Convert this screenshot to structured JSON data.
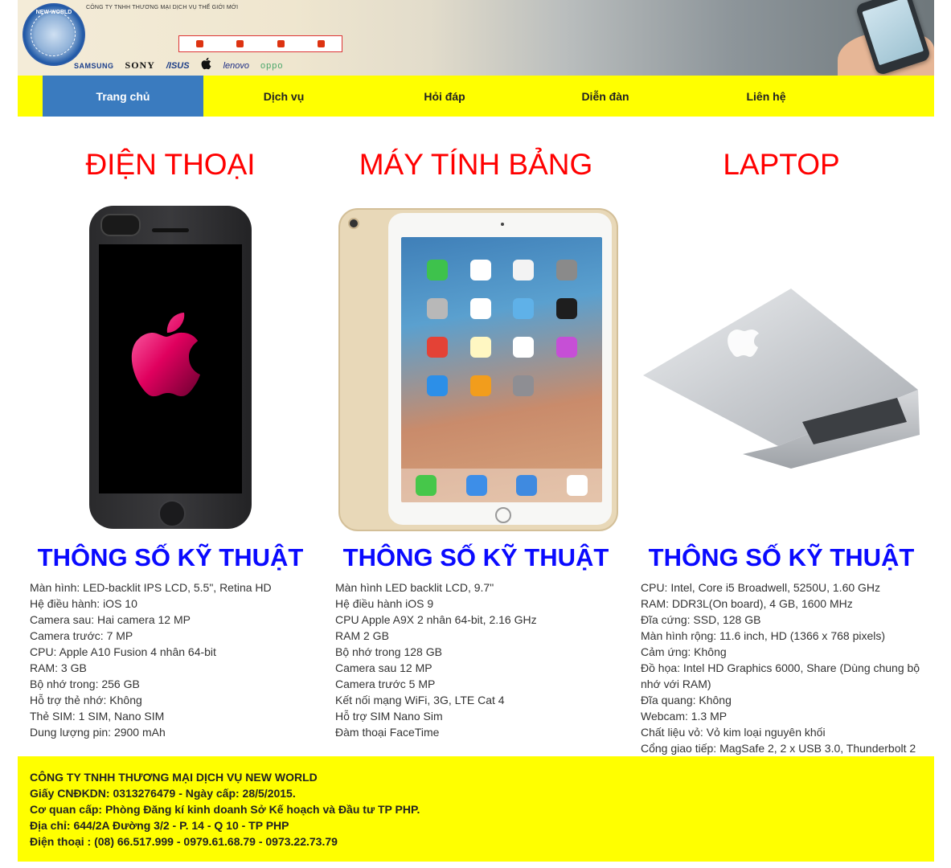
{
  "banner": {
    "company_small": "CÔNG TY TNHH THƯƠNG MẠI DỊCH VỤ THẾ GIỚI MỚI",
    "logo_text": "NEW WORLD",
    "brands": [
      "SAMSUNG",
      "SONY",
      "/ISUS",
      "",
      "lenovo",
      "oppo"
    ]
  },
  "nav": {
    "items": [
      {
        "label": "Trang chủ",
        "active": true
      },
      {
        "label": "Dịch vụ",
        "active": false
      },
      {
        "label": "Hỏi đáp",
        "active": false
      },
      {
        "label": "Diễn đàn",
        "active": false
      },
      {
        "label": "Liên hệ",
        "active": false
      }
    ]
  },
  "columns": [
    {
      "title": "ĐIỆN THOẠI",
      "spec_title": "THÔNG SỐ KỸ THUẬT",
      "specs": [
        "Màn hình: LED-backlit IPS LCD, 5.5\", Retina HD",
        "Hệ điều hành: iOS 10",
        "Camera sau: Hai camera 12 MP",
        "Camera trước: 7 MP",
        "CPU: Apple A10 Fusion 4 nhân 64-bit",
        "RAM: 3 GB",
        "Bộ nhớ trong: 256 GB",
        "Hỗ trợ thẻ nhớ: Không",
        "Thẻ SIM: 1 SIM, Nano SIM",
        "Dung lượng pin: 2900 mAh"
      ]
    },
    {
      "title": "MÁY TÍNH BẢNG",
      "spec_title": "THÔNG SỐ KỸ THUẬT",
      "specs": [
        "Màn hình LED backlit LCD, 9.7\"",
        "Hệ điều hành iOS 9",
        "CPU Apple A9X 2 nhân 64-bit, 2.16 GHz",
        "RAM 2 GB",
        "Bộ nhớ trong 128 GB",
        "Camera sau 12 MP",
        "Camera trước 5 MP",
        "Kết nối mạng WiFi, 3G, LTE Cat 4",
        "Hỗ trợ SIM Nano Sim",
        "Đàm thoại FaceTime"
      ]
    },
    {
      "title": "LAPTOP",
      "spec_title": "THÔNG SỐ KỸ THUẬT",
      "specs": [
        "CPU: Intel, Core i5 Broadwell, 5250U, 1.60 GHz",
        "RAM: DDR3L(On board), 4 GB, 1600 MHz",
        "Đĩa cứng: SSD, 128 GB",
        "Màn hình rộng: 11.6 inch, HD (1366 x 768 pixels)",
        "Cảm ứng: Không",
        "Đồ họa: Intel HD Graphics 6000, Share (Dùng chung bộ nhớ với RAM)",
        "Đĩa quang: Không",
        "Webcam: 1.3 MP",
        "Chất liệu vỏ: Vỏ kim loại nguyên khối",
        "Cổng giao tiếp: MagSafe 2, 2 x USB 3.0, Thunderbolt 2"
      ]
    }
  ],
  "footer": {
    "lines": [
      "CÔNG TY TNHH THƯƠNG MẠI DỊCH VỤ NEW WORLD",
      "Giấy CNĐKDN: 0313276479 - Ngày cấp: 28/5/2015.",
      "Cơ quan cấp: Phòng Đăng kí kinh doanh Sở Kế hoạch và Đầu tư TP PHP.",
      "Địa chỉ: 644/2A Đường 3/2 - P. 14 - Q 10 - TP PHP",
      "Điện thoại : (08) 66.517.999 - 0979.61.68.79 - 0973.22.73.79"
    ]
  },
  "colors": {
    "accent_yellow": "#ffff00",
    "nav_active": "#3a7bbf",
    "title_red": "#ff0000",
    "spec_blue": "#0a0aff"
  },
  "icons": [
    "new-world-logo",
    "apple-logo"
  ]
}
